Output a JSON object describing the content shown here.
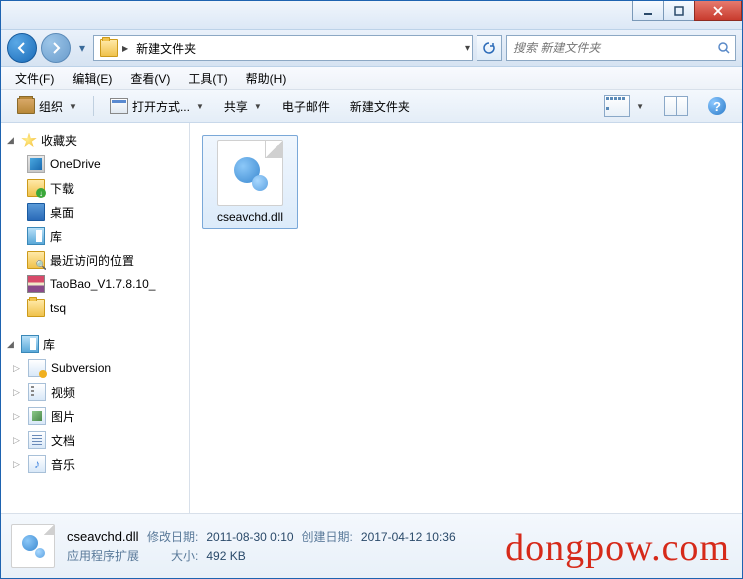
{
  "titlebar": {},
  "nav": {
    "path_label": "新建文件夹",
    "search_placeholder": "搜索 新建文件夹"
  },
  "menu": {
    "file": "文件(F)",
    "edit": "编辑(E)",
    "view": "查看(V)",
    "tools": "工具(T)",
    "help": "帮助(H)"
  },
  "toolbar": {
    "organize": "组织",
    "open_with": "打开方式...",
    "share": "共享",
    "email": "电子邮件",
    "new_folder": "新建文件夹"
  },
  "sidebar": {
    "favorites": {
      "header": "收藏夹",
      "items": [
        {
          "label": "OneDrive",
          "icon": "onedrive"
        },
        {
          "label": "下载",
          "icon": "download"
        },
        {
          "label": "桌面",
          "icon": "desktop"
        },
        {
          "label": "库",
          "icon": "lib"
        },
        {
          "label": "最近访问的位置",
          "icon": "recent"
        },
        {
          "label": "TaoBao_V1.7.8.10_",
          "icon": "rar"
        },
        {
          "label": "tsq",
          "icon": "folder"
        }
      ]
    },
    "libraries": {
      "header": "库",
      "items": [
        {
          "label": "Subversion",
          "icon": "svn"
        },
        {
          "label": "视频",
          "icon": "vid"
        },
        {
          "label": "图片",
          "icon": "pic"
        },
        {
          "label": "文档",
          "icon": "doc"
        },
        {
          "label": "音乐",
          "icon": "mus"
        }
      ]
    }
  },
  "content": {
    "files": [
      {
        "name": "cseavchd.dll"
      }
    ]
  },
  "status": {
    "filename": "cseavchd.dll",
    "filetype": "应用程序扩展",
    "mod_label": "修改日期:",
    "mod_value": "2011-08-30 0:10",
    "size_label": "大小:",
    "size_value": "492 KB",
    "create_label": "创建日期:",
    "create_value": "2017-04-12 10:36"
  },
  "watermark": "dongpow.com"
}
